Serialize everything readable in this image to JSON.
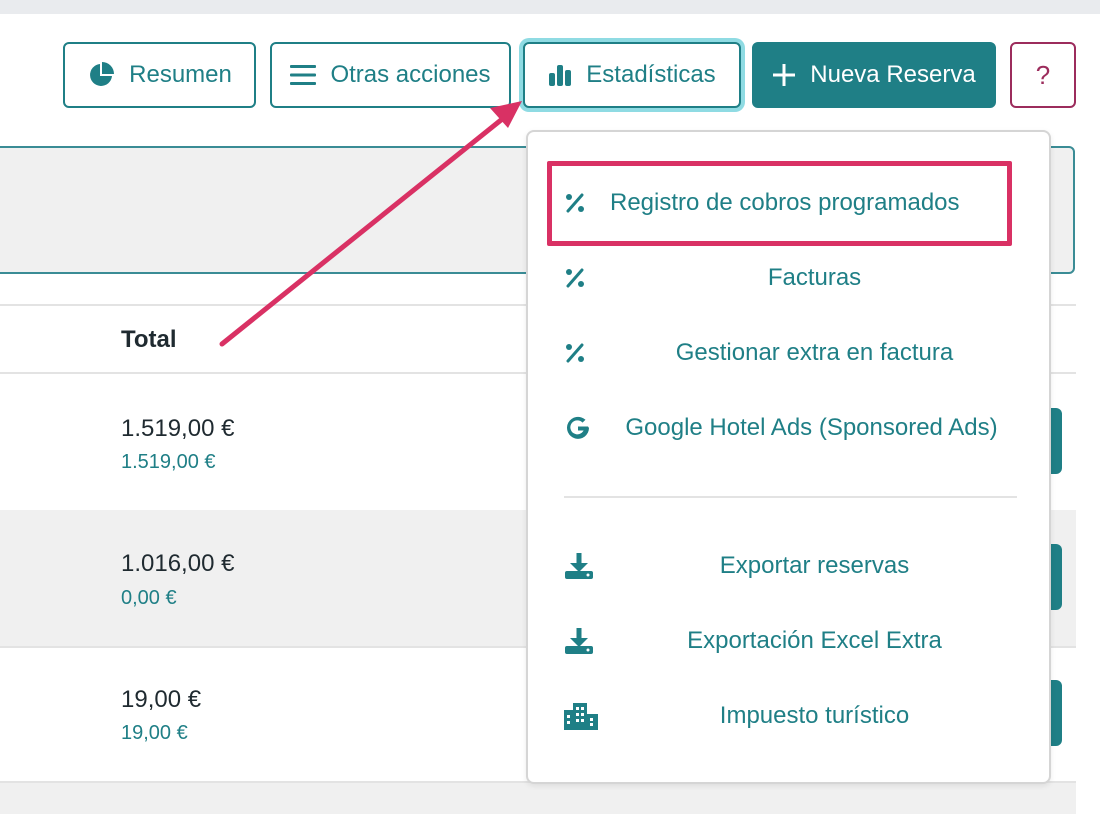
{
  "toolbar": {
    "resumen_label": "Resumen",
    "otras_label": "Otras acciones",
    "estadisticas_label": "Estadísticas",
    "nueva_label": "Nueva Reserva",
    "help_label": "?"
  },
  "table": {
    "total_header": "Total",
    "rows": [
      {
        "total": "1.519,00 €",
        "paid": "1.519,00 €"
      },
      {
        "total": "1.016,00 €",
        "paid": "0,00 €"
      },
      {
        "total": "19,00 €",
        "paid": "19,00 €"
      }
    ]
  },
  "dropdown": {
    "items": [
      {
        "label": "Registro de cobros programados",
        "icon": "percent-icon"
      },
      {
        "label": "Facturas",
        "icon": "percent-icon"
      },
      {
        "label": "Gestionar extra en factura",
        "icon": "percent-icon"
      },
      {
        "label": "Google Hotel Ads (Sponsored Ads)",
        "icon": "google-icon"
      },
      {
        "label": "Exportar reservas",
        "icon": "download-icon"
      },
      {
        "label": "Exportación Excel Extra",
        "icon": "download-icon"
      },
      {
        "label": "Impuesto turístico",
        "icon": "building-icon"
      }
    ]
  },
  "colors": {
    "accent": "#1f7f86",
    "highlight": "#d93164",
    "help": "#9c2c5c"
  }
}
